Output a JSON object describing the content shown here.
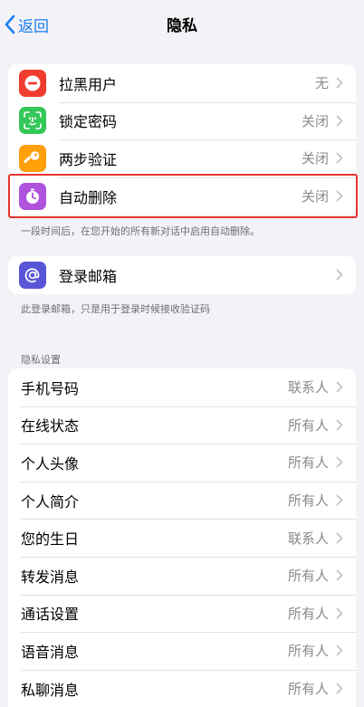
{
  "nav": {
    "back_label": "返回",
    "title": "隐私"
  },
  "group1": {
    "items": [
      {
        "label": "拉黑用户",
        "value": "无",
        "icon": "block-user-icon",
        "color": "#f03c2f"
      },
      {
        "label": "锁定密码",
        "value": "关闭",
        "icon": "face-id-icon",
        "color": "#34c759"
      },
      {
        "label": "两步验证",
        "value": "关闭",
        "icon": "key-icon",
        "color": "#ff9f0a"
      },
      {
        "label": "自动删除",
        "value": "关闭",
        "icon": "timer-icon",
        "color": "#af52de"
      }
    ],
    "footer": "一段时间后，在您开始的所有新对话中启用自动删除。"
  },
  "group2": {
    "items": [
      {
        "label": "登录邮箱",
        "icon": "at-sign-icon",
        "color": "#5856d6"
      }
    ],
    "footer": "此登录邮箱，只是用于登录时候接收验证码"
  },
  "privacy": {
    "header": "隐私设置",
    "items": [
      {
        "label": "手机号码",
        "value": "联系人"
      },
      {
        "label": "在线状态",
        "value": "所有人"
      },
      {
        "label": "个人头像",
        "value": "所有人"
      },
      {
        "label": "个人简介",
        "value": "所有人"
      },
      {
        "label": "您的生日",
        "value": "联系人"
      },
      {
        "label": "转发消息",
        "value": "所有人"
      },
      {
        "label": "通话设置",
        "value": "所有人"
      },
      {
        "label": "语音消息",
        "value": "所有人"
      },
      {
        "label": "私聊消息",
        "value": "所有人"
      }
    ]
  },
  "accent": "#1a7cf2"
}
